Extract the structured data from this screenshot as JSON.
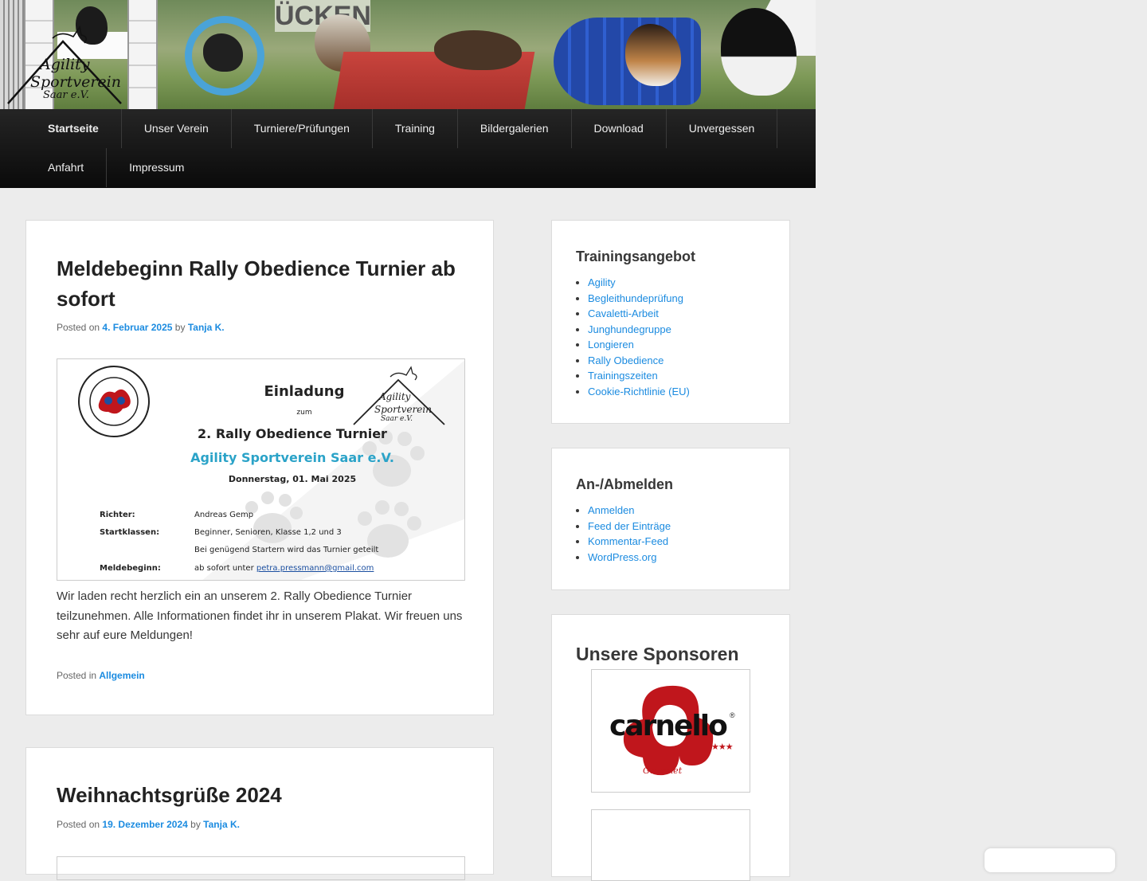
{
  "header": {
    "logo": {
      "line1": "Agility",
      "line2": "Sportverein",
      "line3": "Saar e.V."
    },
    "banner_sign_text": "ÜCKEN"
  },
  "nav": {
    "row1": [
      "Startseite",
      "Unser Verein",
      "Turniere/Prüfungen",
      "Training",
      "Bildergalerien",
      "Download",
      "Unvergessen"
    ],
    "row2": [
      "Anfahrt",
      "Impressum"
    ],
    "active": "Startseite"
  },
  "posts": [
    {
      "title": "Meldebeginn Rally Obedience Turnier ab sofort",
      "posted_on_label": "Posted on",
      "date": "4. Februar 2025",
      "by_label": "by",
      "author": "Tanja K.",
      "flyer": {
        "heading": "Einladung",
        "zum": "zum",
        "event": "2. Rally Obedience Turnier",
        "club": "Agility Sportverein Saar e.V.",
        "date": "Donnerstag, 01. Mai 2025",
        "rows": [
          {
            "label": "Richter:",
            "value": "Andreas Gemp"
          },
          {
            "label": "Startklassen:",
            "value": "Beginner, Senioren, Klasse 1,2 und 3"
          },
          {
            "label": "",
            "value": "Bei genügend Startern wird das Turnier geteilt"
          },
          {
            "label": "Meldebeginn:",
            "value": "ab sofort unter",
            "link": "petra.pressmann@gmail.com"
          }
        ],
        "seal_text": "DEUTSCHER VERBAND DER GEBRAUCHSHUNDSPORTVEREINE",
        "logo": {
          "line1": "Agility",
          "line2": "Sportverein",
          "line3": "Saar e.V."
        }
      },
      "body": "Wir laden recht herzlich ein an unserem 2. Rally Obedience Turnier teilzunehmen. Alle Informationen findet ihr in unserem Plakat. Wir freuen uns sehr auf eure Meldungen!",
      "posted_in_label": "Posted in",
      "category": "Allgemein"
    },
    {
      "title": "Weihnachtsgrüße 2024",
      "posted_on_label": "Posted on",
      "date": "19. Dezember 2024",
      "by_label": "by",
      "author": "Tanja K."
    }
  ],
  "sidebar": {
    "training": {
      "title": "Trainingsangebot",
      "items": [
        "Agility",
        "Begleithundeprüfung",
        "Cavaletti-Arbeit",
        "Junghundegruppe",
        "Longieren",
        "Rally Obedience",
        "Trainingszeiten",
        "Cookie-Richtlinie (EU)"
      ]
    },
    "login": {
      "title": "An-/Abmelden",
      "items": [
        "Anmelden",
        "Feed der Einträge",
        "Kommentar-Feed",
        "WordPress.org"
      ]
    },
    "sponsors": {
      "title": "Unsere Sponsoren",
      "sponsor1": {
        "name": "carnello",
        "sub": "Gourmet",
        "stars": "★★★",
        "reg": "®"
      }
    }
  },
  "colors": {
    "link": "#1b8be0",
    "nav_bg": "#111111",
    "paw_red": "#c0161c"
  }
}
